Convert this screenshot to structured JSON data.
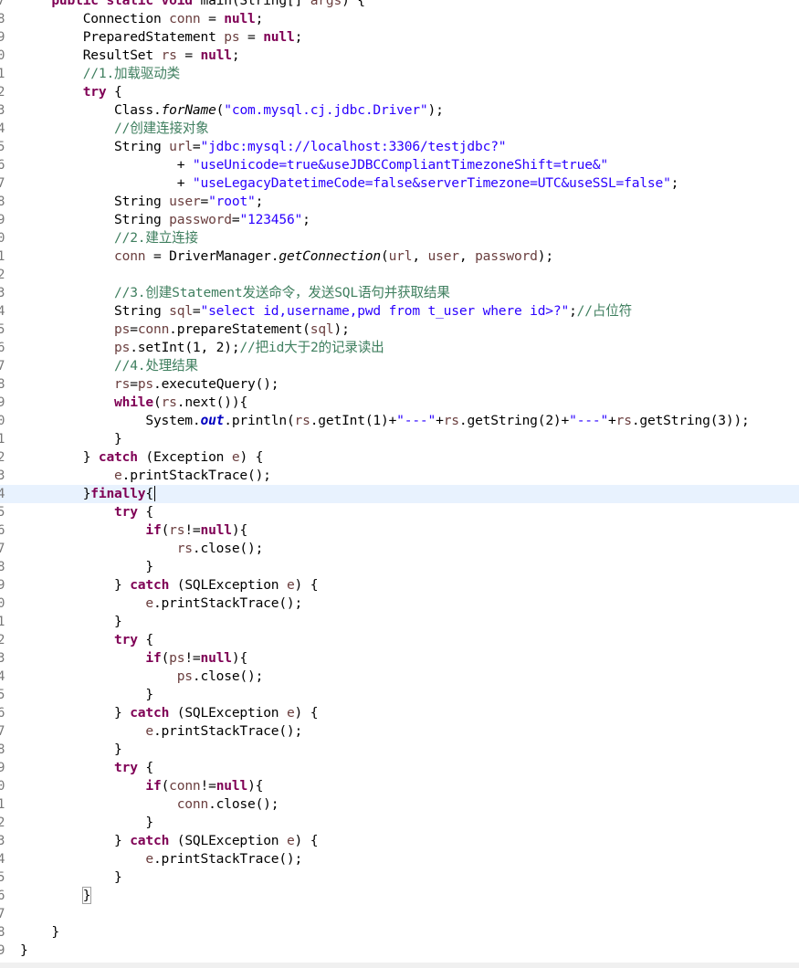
{
  "colors": {
    "keyword": "#7f0055",
    "string": "#2a00ff",
    "comment": "#3f7f5f",
    "variable": "#6a3e3e",
    "field": "#0000c0",
    "line_number": "#787878",
    "current_line": "#e8f2fe",
    "background": "#ffffff"
  },
  "editor": {
    "lines": [
      {
        "n": "7",
        "marker": "fold-icon",
        "tokens": [
          [
            "kw",
            "    public static void "
          ],
          [
            "pl",
            "main(String[] "
          ],
          [
            "var",
            "args"
          ],
          [
            "pl",
            ") {"
          ]
        ]
      },
      {
        "n": "8",
        "tokens": [
          [
            "pl",
            "        Connection "
          ],
          [
            "var",
            "conn"
          ],
          [
            "pl",
            " = "
          ],
          [
            "kw",
            "null"
          ],
          [
            "pl",
            ";"
          ]
        ]
      },
      {
        "n": "9",
        "tokens": [
          [
            "pl",
            "        PreparedStatement "
          ],
          [
            "var",
            "ps"
          ],
          [
            "pl",
            " = "
          ],
          [
            "kw",
            "null"
          ],
          [
            "pl",
            ";"
          ]
        ]
      },
      {
        "n": "0",
        "tokens": [
          [
            "pl",
            "        ResultSet "
          ],
          [
            "var",
            "rs"
          ],
          [
            "pl",
            " = "
          ],
          [
            "kw",
            "null"
          ],
          [
            "pl",
            ";"
          ]
        ]
      },
      {
        "n": "1",
        "tokens": [
          [
            "cm",
            "        //1.加载驱动类"
          ]
        ]
      },
      {
        "n": "2",
        "tokens": [
          [
            "kw",
            "        try"
          ],
          [
            "pl",
            " {"
          ]
        ]
      },
      {
        "n": "3",
        "tokens": [
          [
            "pl",
            "            Class."
          ],
          [
            "st",
            "forName"
          ],
          [
            "pl",
            "("
          ],
          [
            "str",
            "\"com.mysql.cj.jdbc.Driver\""
          ],
          [
            "pl",
            ");"
          ]
        ]
      },
      {
        "n": "4",
        "tokens": [
          [
            "cm",
            "            //创建连接对象"
          ]
        ]
      },
      {
        "n": "5",
        "tokens": [
          [
            "pl",
            "            String "
          ],
          [
            "var",
            "url"
          ],
          [
            "pl",
            "="
          ],
          [
            "str",
            "\"jdbc:mysql://localhost:3306/testjdbc?\""
          ]
        ]
      },
      {
        "n": "6",
        "tokens": [
          [
            "pl",
            "                    + "
          ],
          [
            "str",
            "\"useUnicode=true&useJDBCCompliantTimezoneShift=true&\""
          ]
        ]
      },
      {
        "n": "7",
        "tokens": [
          [
            "pl",
            "                    + "
          ],
          [
            "str",
            "\"useLegacyDatetimeCode=false&serverTimezone=UTC&useSSL=false\""
          ],
          [
            "pl",
            ";"
          ]
        ]
      },
      {
        "n": "8",
        "tokens": [
          [
            "pl",
            "            String "
          ],
          [
            "var",
            "user"
          ],
          [
            "pl",
            "="
          ],
          [
            "str",
            "\"root\""
          ],
          [
            "pl",
            ";"
          ]
        ]
      },
      {
        "n": "9",
        "tokens": [
          [
            "pl",
            "            String "
          ],
          [
            "var",
            "password"
          ],
          [
            "pl",
            "="
          ],
          [
            "str",
            "\"123456\""
          ],
          [
            "pl",
            ";"
          ]
        ]
      },
      {
        "n": "0",
        "tokens": [
          [
            "cm",
            "            //2.建立连接"
          ]
        ]
      },
      {
        "n": "1",
        "tokens": [
          [
            "var",
            "            conn"
          ],
          [
            "pl",
            " = DriverManager."
          ],
          [
            "st",
            "getConnection"
          ],
          [
            "pl",
            "("
          ],
          [
            "var",
            "url"
          ],
          [
            "pl",
            ", "
          ],
          [
            "var",
            "user"
          ],
          [
            "pl",
            ", "
          ],
          [
            "var",
            "password"
          ],
          [
            "pl",
            ");"
          ]
        ]
      },
      {
        "n": "2",
        "tokens": []
      },
      {
        "n": "3",
        "tokens": [
          [
            "cm",
            "            //3.创建Statement发送命令，发送SQL语句并获取结果"
          ]
        ]
      },
      {
        "n": "4",
        "tokens": [
          [
            "pl",
            "            String "
          ],
          [
            "var",
            "sql"
          ],
          [
            "pl",
            "="
          ],
          [
            "str",
            "\"select id,username,pwd from t_user where id>?\""
          ],
          [
            "pl",
            ";"
          ],
          [
            "cm",
            "//占位符"
          ]
        ]
      },
      {
        "n": "5",
        "tokens": [
          [
            "var",
            "            ps"
          ],
          [
            "pl",
            "="
          ],
          [
            "var",
            "conn"
          ],
          [
            "pl",
            ".prepareStatement("
          ],
          [
            "var",
            "sql"
          ],
          [
            "pl",
            ");"
          ]
        ]
      },
      {
        "n": "6",
        "tokens": [
          [
            "var",
            "            ps"
          ],
          [
            "pl",
            ".setInt(1, 2);"
          ],
          [
            "cm",
            "//把id大于2的记录读出"
          ]
        ]
      },
      {
        "n": "7",
        "tokens": [
          [
            "cm",
            "            //4.处理结果"
          ]
        ]
      },
      {
        "n": "8",
        "tokens": [
          [
            "var",
            "            rs"
          ],
          [
            "pl",
            "="
          ],
          [
            "var",
            "ps"
          ],
          [
            "pl",
            ".executeQuery();"
          ]
        ]
      },
      {
        "n": "9",
        "tokens": [
          [
            "kw",
            "            while"
          ],
          [
            "pl",
            "("
          ],
          [
            "var",
            "rs"
          ],
          [
            "pl",
            ".next()){"
          ]
        ]
      },
      {
        "n": "0",
        "tokens": [
          [
            "pl",
            "                System."
          ],
          [
            "fld",
            "out"
          ],
          [
            "pl",
            ".println("
          ],
          [
            "var",
            "rs"
          ],
          [
            "pl",
            ".getInt(1)+"
          ],
          [
            "str",
            "\"---\""
          ],
          [
            "pl",
            "+"
          ],
          [
            "var",
            "rs"
          ],
          [
            "pl",
            ".getString(2)+"
          ],
          [
            "str",
            "\"---\""
          ],
          [
            "pl",
            "+"
          ],
          [
            "var",
            "rs"
          ],
          [
            "pl",
            ".getString(3));"
          ]
        ]
      },
      {
        "n": "1",
        "tokens": [
          [
            "pl",
            "            }"
          ]
        ]
      },
      {
        "n": "2",
        "tokens": [
          [
            "pl",
            "        } "
          ],
          [
            "kw",
            "catch"
          ],
          [
            "pl",
            " (Exception "
          ],
          [
            "var",
            "e"
          ],
          [
            "pl",
            ") {"
          ]
        ]
      },
      {
        "n": "3",
        "tokens": [
          [
            "var",
            "            e"
          ],
          [
            "pl",
            ".printStackTrace();"
          ]
        ]
      },
      {
        "n": "4",
        "current": true,
        "caret": true,
        "tokens": [
          [
            "pl",
            "        }"
          ],
          [
            "kw",
            "finally"
          ],
          [
            "pl",
            "{"
          ]
        ]
      },
      {
        "n": "5",
        "tokens": [
          [
            "kw",
            "            try"
          ],
          [
            "pl",
            " {"
          ]
        ]
      },
      {
        "n": "6",
        "tokens": [
          [
            "kw",
            "                if"
          ],
          [
            "pl",
            "("
          ],
          [
            "var",
            "rs"
          ],
          [
            "pl",
            "!="
          ],
          [
            "kw",
            "null"
          ],
          [
            "pl",
            "){"
          ]
        ]
      },
      {
        "n": "7",
        "tokens": [
          [
            "var",
            "                    rs"
          ],
          [
            "pl",
            ".close();"
          ]
        ]
      },
      {
        "n": "8",
        "tokens": [
          [
            "pl",
            "                }"
          ]
        ]
      },
      {
        "n": "9",
        "tokens": [
          [
            "pl",
            "            } "
          ],
          [
            "kw",
            "catch"
          ],
          [
            "pl",
            " (SQLException "
          ],
          [
            "var",
            "e"
          ],
          [
            "pl",
            ") {"
          ]
        ]
      },
      {
        "n": "0",
        "tokens": [
          [
            "var",
            "                e"
          ],
          [
            "pl",
            ".printStackTrace();"
          ]
        ]
      },
      {
        "n": "1",
        "tokens": [
          [
            "pl",
            "            }"
          ]
        ]
      },
      {
        "n": "2",
        "tokens": [
          [
            "kw",
            "            try"
          ],
          [
            "pl",
            " {"
          ]
        ]
      },
      {
        "n": "3",
        "tokens": [
          [
            "kw",
            "                if"
          ],
          [
            "pl",
            "("
          ],
          [
            "var",
            "ps"
          ],
          [
            "pl",
            "!="
          ],
          [
            "kw",
            "null"
          ],
          [
            "pl",
            "){"
          ]
        ]
      },
      {
        "n": "4",
        "tokens": [
          [
            "var",
            "                    ps"
          ],
          [
            "pl",
            ".close();"
          ]
        ]
      },
      {
        "n": "5",
        "tokens": [
          [
            "pl",
            "                }"
          ]
        ]
      },
      {
        "n": "6",
        "tokens": [
          [
            "pl",
            "            } "
          ],
          [
            "kw",
            "catch"
          ],
          [
            "pl",
            " (SQLException "
          ],
          [
            "var",
            "e"
          ],
          [
            "pl",
            ") {"
          ]
        ]
      },
      {
        "n": "7",
        "tokens": [
          [
            "var",
            "                e"
          ],
          [
            "pl",
            ".printStackTrace();"
          ]
        ]
      },
      {
        "n": "8",
        "tokens": [
          [
            "pl",
            "            }"
          ]
        ]
      },
      {
        "n": "9",
        "tokens": [
          [
            "kw",
            "            try"
          ],
          [
            "pl",
            " {"
          ]
        ]
      },
      {
        "n": "0",
        "tokens": [
          [
            "kw",
            "                if"
          ],
          [
            "pl",
            "("
          ],
          [
            "var",
            "conn"
          ],
          [
            "pl",
            "!="
          ],
          [
            "kw",
            "null"
          ],
          [
            "pl",
            "){"
          ]
        ]
      },
      {
        "n": "1",
        "tokens": [
          [
            "var",
            "                    conn"
          ],
          [
            "pl",
            ".close();"
          ]
        ]
      },
      {
        "n": "2",
        "tokens": [
          [
            "pl",
            "                }"
          ]
        ]
      },
      {
        "n": "3",
        "tokens": [
          [
            "pl",
            "            } "
          ],
          [
            "kw",
            "catch"
          ],
          [
            "pl",
            " (SQLException "
          ],
          [
            "var",
            "e"
          ],
          [
            "pl",
            ") {"
          ]
        ]
      },
      {
        "n": "4",
        "tokens": [
          [
            "var",
            "                e"
          ],
          [
            "pl",
            ".printStackTrace();"
          ]
        ]
      },
      {
        "n": "5",
        "tokens": [
          [
            "pl",
            "            }"
          ]
        ]
      },
      {
        "n": "6",
        "bracket": true,
        "tokens": [
          [
            "pl",
            "        }"
          ]
        ]
      },
      {
        "n": "7",
        "tokens": []
      },
      {
        "n": "8",
        "tokens": [
          [
            "pl",
            "    }"
          ]
        ]
      },
      {
        "n": "9",
        "tokens": [
          [
            "pl",
            "}"
          ]
        ]
      }
    ]
  }
}
